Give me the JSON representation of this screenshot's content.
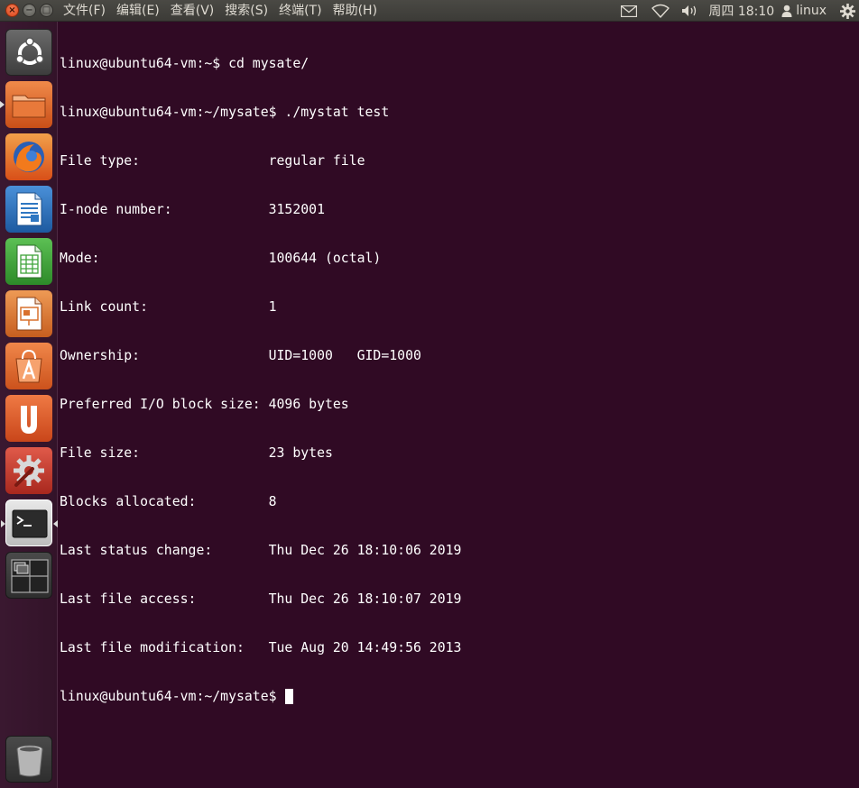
{
  "top_panel": {
    "menu": [
      "文件(F)",
      "编辑(E)",
      "查看(V)",
      "搜索(S)",
      "终端(T)",
      "帮助(H)"
    ],
    "clock": "周四 18:10",
    "user": "linux",
    "window_buttons": {
      "close": "×",
      "minimize": "−",
      "maximize": "□"
    }
  },
  "launcher": {
    "items": [
      {
        "name": "dash-home",
        "icon": "ubuntu-logo-icon",
        "color": "#5a5a5a"
      },
      {
        "name": "files",
        "icon": "folder-icon",
        "color": "#e06a2c"
      },
      {
        "name": "firefox",
        "icon": "firefox-icon",
        "color": "#e5661d"
      },
      {
        "name": "libreoffice-writer",
        "icon": "writer-doc-icon",
        "color": "#2e77c2"
      },
      {
        "name": "libreoffice-calc",
        "icon": "calc-sheet-icon",
        "color": "#3fa33a"
      },
      {
        "name": "libreoffice-impress",
        "icon": "impress-slide-icon",
        "color": "#d9702d"
      },
      {
        "name": "ubuntu-software-center",
        "icon": "software-center-icon",
        "color": "#e2682d"
      },
      {
        "name": "ubuntu-one",
        "icon": "ubuntu-one-icon",
        "color": "#e05a27"
      },
      {
        "name": "system-settings",
        "icon": "settings-wrench-gear-icon",
        "color": "#c74035"
      },
      {
        "name": "terminal",
        "icon": "terminal-icon",
        "color": "#4a4a4a"
      },
      {
        "name": "workspace-switcher",
        "icon": "workspace-switcher-icon",
        "color": "#3a3a3a"
      },
      {
        "name": "trash",
        "icon": "trash-icon",
        "color": "#3a3a3a"
      }
    ]
  },
  "terminal": {
    "lines": [
      "linux@ubuntu64-vm:~$ cd mysate/",
      "linux@ubuntu64-vm:~/mysate$ ./mystat test",
      "File type:                regular file",
      "I-node number:            3152001",
      "Mode:                     100644 (octal)",
      "Link count:               1",
      "Ownership:                UID=1000   GID=1000",
      "Preferred I/O block size: 4096 bytes",
      "File size:                23 bytes",
      "Blocks allocated:         8",
      "Last status change:       Thu Dec 26 18:10:06 2019",
      "Last file access:         Thu Dec 26 18:10:07 2019",
      "Last file modification:   Tue Aug 20 14:49:56 2013"
    ],
    "prompt": "linux@ubuntu64-vm:~/mysate$ "
  }
}
